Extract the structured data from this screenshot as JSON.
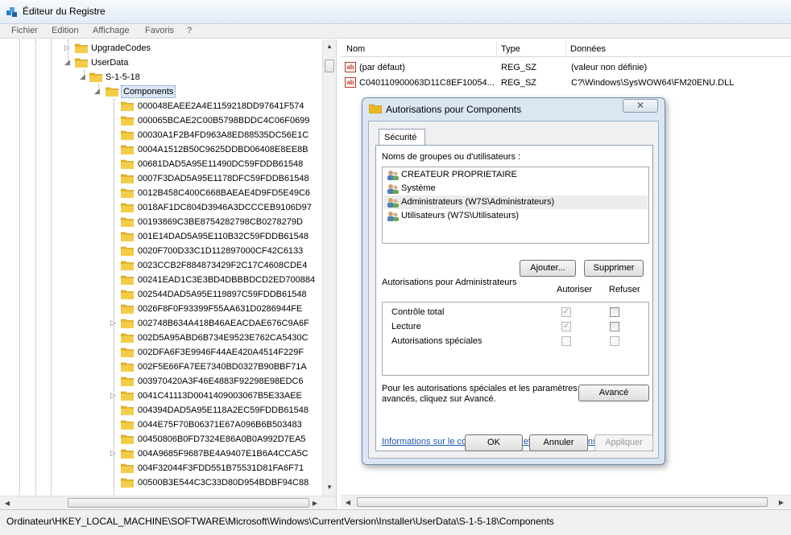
{
  "window": {
    "title": "Éditeur du Registre"
  },
  "menu": [
    "Fichier",
    "Edition",
    "Affichage",
    "Favoris",
    "?"
  ],
  "tree": {
    "upgrade_codes": "UpgradeCodes",
    "user_data": "UserData",
    "sid": "S-1-5-18",
    "components": "Components",
    "keys": [
      "000048EAEE2A4E1159218DD97641F574",
      "000065BCAE2C00B5798BDDC4C06F0699",
      "00030A1F2B4FD963A8ED88535DC56E1C",
      "0004A1512B50C9625DDBD06408E8EE8B",
      "00681DAD5A95E11490DC59FDDB61548",
      "0007F3DAD5A95E1178DFC59FDDB61548",
      "0012B458C400C668BAEAE4D9FD5E49C6",
      "0018AF1DC804D3946A3DCCCEB9106D97",
      "00193869C3BE8754282798CB0278279D",
      "001E14DAD5A95E110B32C59FDDB61548",
      "0020F700D33C1D112897000CF42C6133",
      "0023CCB2F884873429F2C17C4608CDE4",
      "00241EAD1C3E3BD4DBBBDCD2ED700884",
      "002544DAD5A95E119897C59FDDB61548",
      "0026F8F0F93399F55AA631D0286944FE",
      "002748B634A418B46AEACDAE676C9A6F",
      "002D5A95ABD6B734E9523E762CA5430C",
      "002DFA6F3E9946F44AE420A4514F229F",
      "002F5E66FA7EE7340BD0327B90BBF71A",
      "003970420A3F46E4883F92298E98EDC6",
      "0041C41113D0041409003067B5E33AEE",
      "004394DAD5A95E118A2EC59FDDB61548",
      "0044E75F70B06371E67A096B6B503483",
      "00450806B0FD7324E86A0B0A992D7EA5",
      "004A9685F9687BE4A9407E1B6A4CCA5C",
      "004F32044F3FDD551B75531D81FA6F71",
      "00500B3E544C3C33D80D954BDBF94C88"
    ]
  },
  "values_pane": {
    "headers": {
      "name": "Nom",
      "type": "Type",
      "data": "Données"
    },
    "rows": [
      {
        "name": "(par défaut)",
        "type": "REG_SZ",
        "data": "(valeur non définie)"
      },
      {
        "name": "C040110900063D11C8EF10054...",
        "type": "REG_SZ",
        "data": "C?\\Windows\\SysWOW64\\FM20ENU.DLL"
      }
    ]
  },
  "status_bar": "Ordinateur\\HKEY_LOCAL_MACHINE\\SOFTWARE\\Microsoft\\Windows\\CurrentVersion\\Installer\\UserData\\S-1-5-18\\Components",
  "dialog": {
    "title": "Autorisations pour Components",
    "close_glyph": "✕",
    "tab": "Sécurité",
    "groups_label": "Noms de groupes ou d'utilisateurs :",
    "users": [
      "CREATEUR PROPRIETAIRE",
      "Système",
      "Administrateurs (W7S\\Administrateurs)",
      "Utilisateurs (W7S\\Utilisateurs)"
    ],
    "add_button": "Ajouter...",
    "remove_button": "Supprimer",
    "perms_for": "Autorisations pour Administrateurs",
    "allow_header": "Autoriser",
    "deny_header": "Refuser",
    "permissions": [
      {
        "name": "Contrôle total",
        "allow": true,
        "deny": false
      },
      {
        "name": "Lecture",
        "allow": true,
        "deny": false
      },
      {
        "name": "Autorisations spéciales",
        "allow": false,
        "deny": false
      }
    ],
    "special_line1": "Pour les autorisations spéciales et les paramètres",
    "special_line2": "avancés, cliquez sur Avancé.",
    "advanced_button": "Avancé",
    "info_link": "Informations sur le contrôle d'accès et les autorisations",
    "ok_button": "OK",
    "cancel_button": "Annuler",
    "apply_button": "Appliquer"
  },
  "colors": {
    "folder": "#e8b923",
    "link": "#1a55b5",
    "dialog_frame": "#dbe6f3"
  }
}
